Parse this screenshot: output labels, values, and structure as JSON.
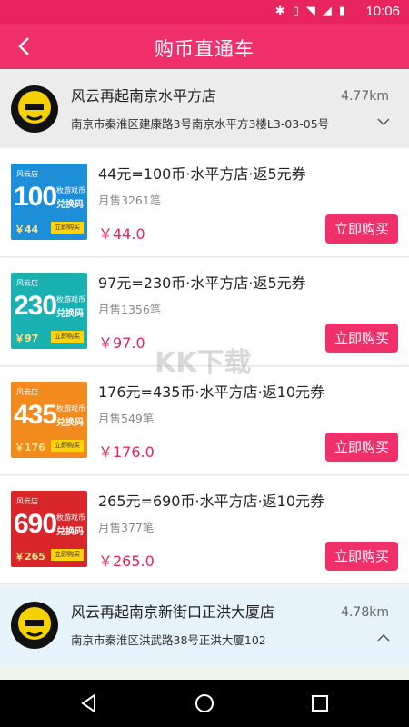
{
  "status_bar": {
    "time": "10:06"
  },
  "app_bar": {
    "title": "购币直通车"
  },
  "stores": [
    {
      "name": "风云再起南京水平方店",
      "address": "南京市秦淮区建康路3号南京水平方3楼L3-03-05号",
      "distance": "4.77km"
    },
    {
      "name": "风云再起南京新街口正洪大厦店",
      "address": "南京市秦淮区洪武路38号正洪大厦102",
      "distance": "4.78km"
    }
  ],
  "products": [
    {
      "title": "44元=100币·水平方店·返5元券",
      "sales": "月售3261笔",
      "price": "￥44.0",
      "buy_label": "立即购买",
      "thumb": {
        "brand": "风云店",
        "big": "100",
        "sub1": "枚游戏币",
        "sub2": "兑换码",
        "price": "￥44",
        "btn": "立即购买",
        "color": "#1c8fd8"
      }
    },
    {
      "title": "97元=230币·水平方店·返5元券",
      "sales": "月售1356笔",
      "price": "￥97.0",
      "buy_label": "立即购买",
      "thumb": {
        "brand": "风云店",
        "big": "230",
        "sub1": "枚游戏币",
        "sub2": "兑换码",
        "price": "￥97",
        "btn": "立即购买",
        "color": "#19b1b1"
      }
    },
    {
      "title": "176元=435币·水平方店·返10元券",
      "sales": "月售549笔",
      "price": "￥176.0",
      "buy_label": "立即购买",
      "thumb": {
        "brand": "风云店",
        "big": "435",
        "sub1": "枚游戏币",
        "sub2": "兑换码",
        "price": "￥176",
        "btn": "立即购买",
        "color": "#f28a1e"
      }
    },
    {
      "title": "265元=690币·水平方店·返10元券",
      "sales": "月售377笔",
      "price": "￥265.0",
      "buy_label": "立即购买",
      "thumb": {
        "brand": "风云店",
        "big": "690",
        "sub1": "枚游戏币",
        "sub2": "兑换码",
        "price": "￥265",
        "btn": "立即购买",
        "color": "#d8262b"
      }
    }
  ],
  "watermark": "KK下载",
  "colors": {
    "accent": "#f0306a",
    "status_bar": "#e8245f"
  }
}
